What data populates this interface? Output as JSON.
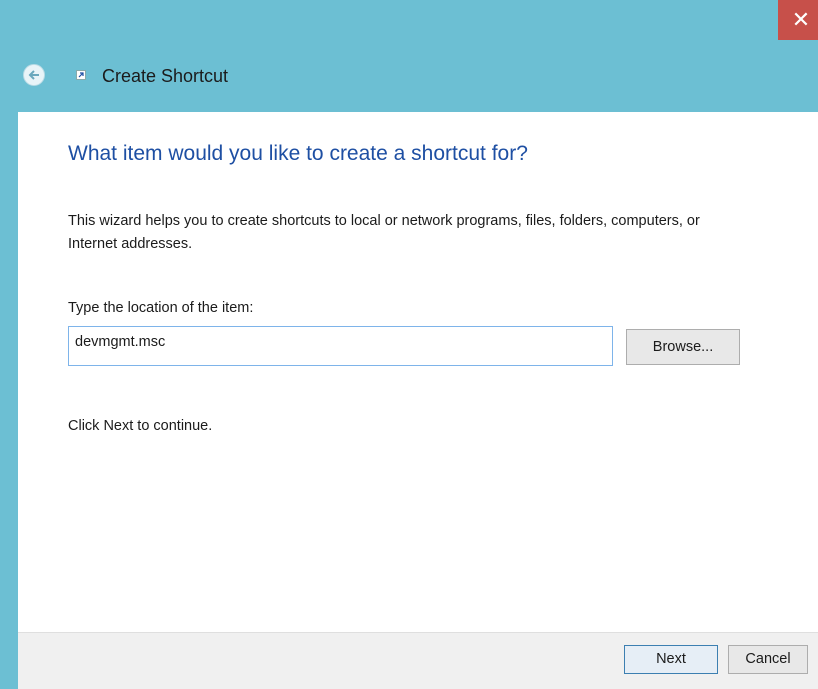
{
  "window": {
    "close_label": "✕",
    "accent_color": "#6cbfd3",
    "close_color": "#c7504a"
  },
  "nav": {
    "back_icon": "back-arrow-icon",
    "app_icon": "shortcut-icon",
    "title": "Create Shortcut"
  },
  "wizard": {
    "heading": "What item would you like to create a shortcut for?",
    "intro": "This wizard helps you to create shortcuts to local or network programs, files, folders, computers, or Internet addresses.",
    "location_label": "Type the location of the item:",
    "location_value": "devmgmt.msc",
    "browse_label": "Browse...",
    "hint": "Click Next to continue.",
    "heading_color": "#1e4fa3"
  },
  "footer": {
    "next_label": "Next",
    "cancel_label": "Cancel"
  }
}
